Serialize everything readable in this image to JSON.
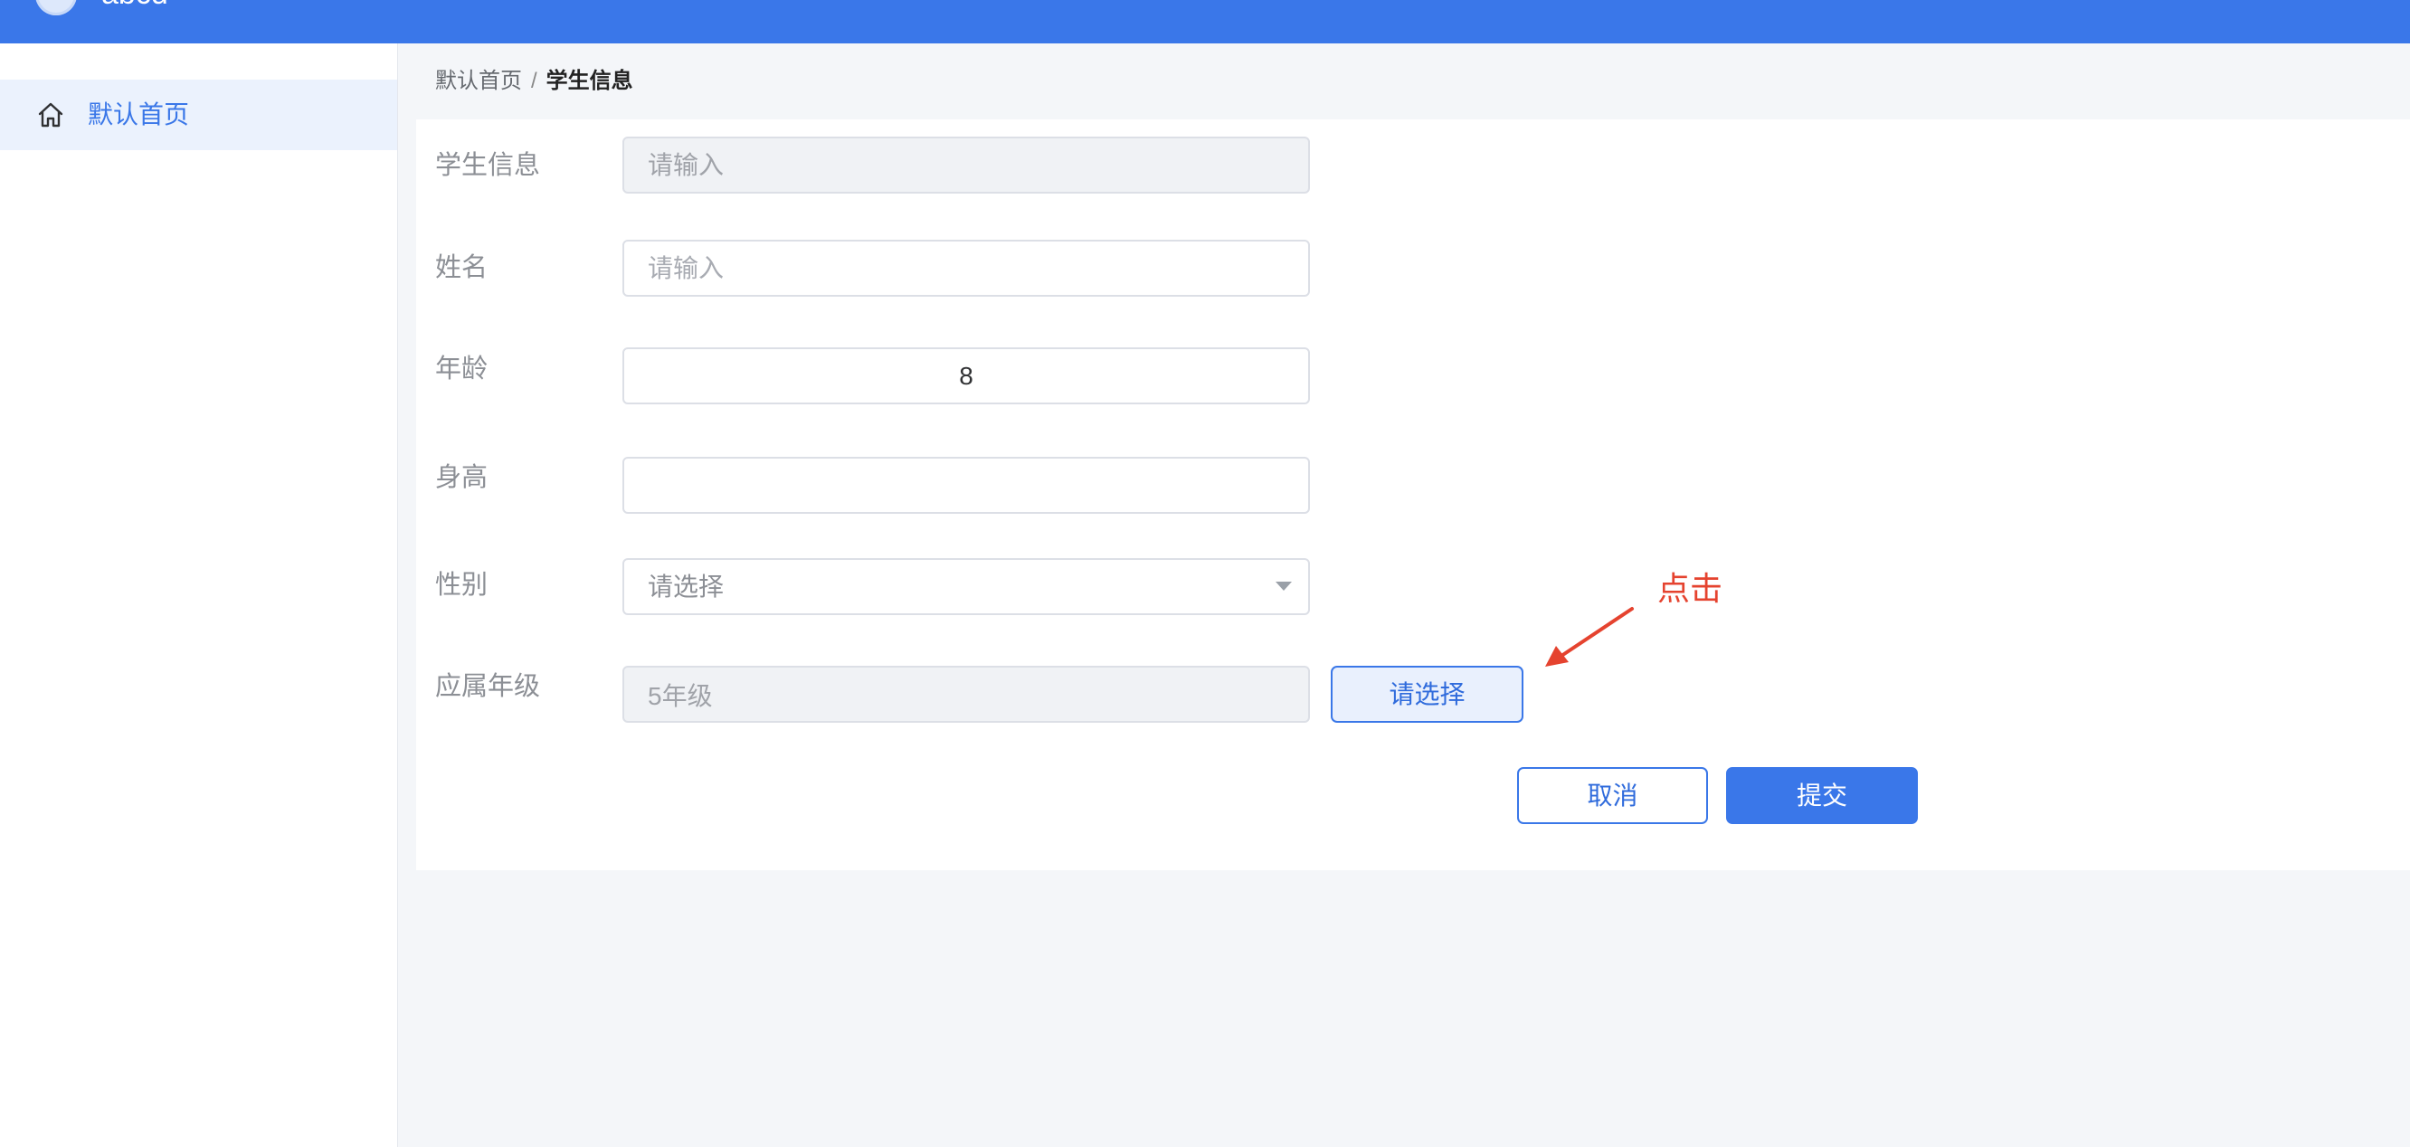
{
  "header": {
    "app_name": "abcd",
    "logo_icon": "logo-icon"
  },
  "sidebar": {
    "items": [
      {
        "label": "默认首页",
        "icon": "home-icon",
        "active": true
      }
    ]
  },
  "breadcrumb": {
    "home": "默认首页",
    "separator": "/",
    "current": "学生信息"
  },
  "form": {
    "student_info": {
      "label": "学生信息",
      "placeholder": "请输入",
      "disabled": true
    },
    "name": {
      "label": "姓名",
      "placeholder": "请输入"
    },
    "age": {
      "label": "年龄",
      "value": "8"
    },
    "height": {
      "label": "身高",
      "value": ""
    },
    "gender": {
      "label": "性别",
      "placeholder": "请选择",
      "icon": "caret-down-icon"
    },
    "grade": {
      "label": "应属年级",
      "value": "5年级",
      "disabled": true,
      "button_label": "请选择"
    }
  },
  "annotation": {
    "text": "点击",
    "color": "#e5432f"
  },
  "actions": {
    "cancel_label": "取消",
    "submit_label": "提交"
  },
  "colors": {
    "primary": "#3a77e9",
    "sidebar_active_bg": "#ebf2fd",
    "page_bg": "#f4f6f9",
    "disabled_bg": "#f0f2f5"
  }
}
